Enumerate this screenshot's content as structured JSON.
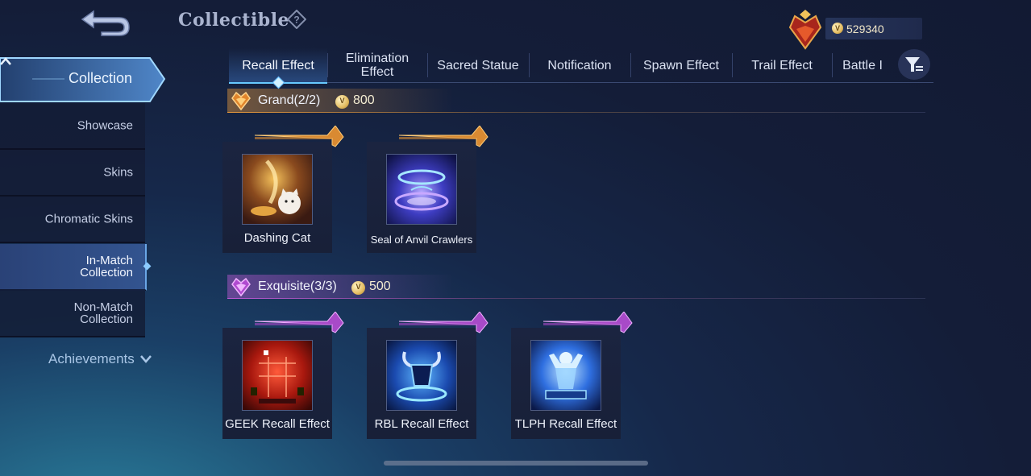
{
  "header": {
    "title": "Collectible",
    "currency_value": "529340"
  },
  "sidebar": {
    "collection_label": "Collection",
    "items": [
      {
        "label": "Showcase"
      },
      {
        "label": "Skins"
      },
      {
        "label": "Chromatic Skins"
      },
      {
        "label": "In-Match\nCollection",
        "active": true
      },
      {
        "label": "Non-Match\nCollection"
      }
    ],
    "achievements_label": "Achievements"
  },
  "tabs": [
    {
      "label": "Recall Effect",
      "active": true
    },
    {
      "label": "Elimination\nEffect"
    },
    {
      "label": "Sacred Statue"
    },
    {
      "label": "Notification"
    },
    {
      "label": "Spawn Effect"
    },
    {
      "label": "Trail Effect"
    },
    {
      "label": "Battle I"
    }
  ],
  "sections": [
    {
      "name": "Grand(2/2)",
      "price": "800",
      "tier_color": "#e89a3c",
      "items": [
        {
          "name": "Dashing Cat",
          "icon": "dashing-cat-icon"
        },
        {
          "name": "Seal of Anvil Crawlers",
          "icon": "anvil-crawlers-seal-icon"
        }
      ]
    },
    {
      "name": "Exquisite(3/3)",
      "price": "500",
      "tier_color": "#c05ad8",
      "items": [
        {
          "name": "GEEK Recall Effect",
          "icon": "geek-recall-icon"
        },
        {
          "name": "RBL Recall Effect",
          "icon": "rbl-recall-icon"
        },
        {
          "name": "TLPH Recall Effect",
          "icon": "tlph-recall-icon"
        }
      ]
    }
  ]
}
